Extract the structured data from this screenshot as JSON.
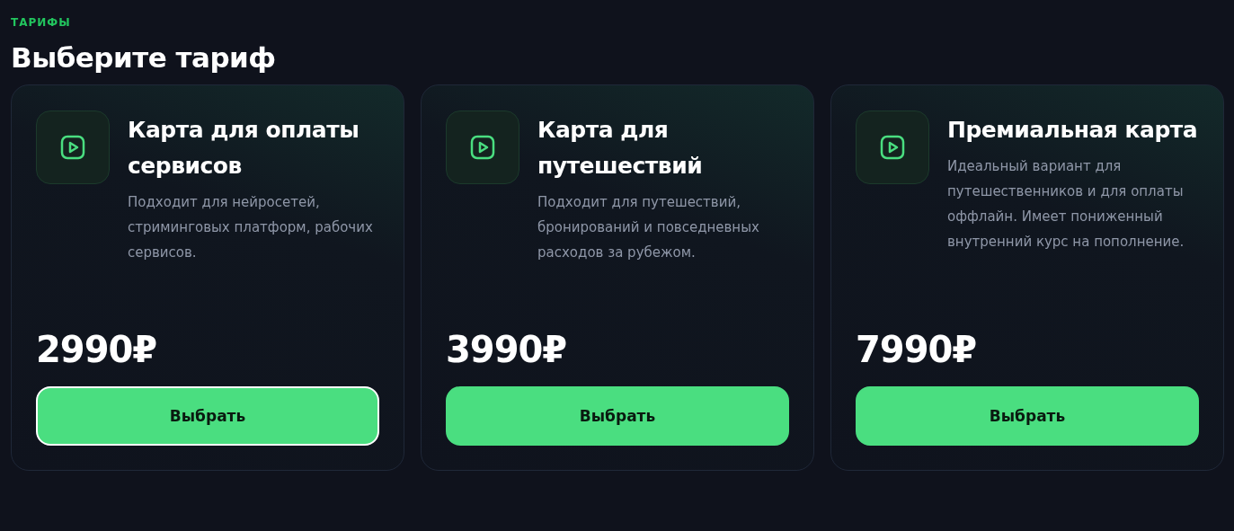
{
  "section_label": "ТАРИФЫ",
  "heading": "Выберите тариф",
  "plans": [
    {
      "title": "Карта для оплаты сервисов",
      "description": "Подходит для нейросетей, стриминговых платформ, рабочих сервисов.",
      "price": "2990₽",
      "button": "Выбрать",
      "focused": true
    },
    {
      "title": "Карта для путешествий",
      "description": "Подходит для путешествий, бронирований и повседневных расходов за рубежом.",
      "price": "3990₽",
      "button": "Выбрать",
      "focused": false
    },
    {
      "title": "Премиальная карта",
      "description": "Идеальный вариант для путешественников и для оплаты оффлайн. Имеет пониженный внутренний курс на пополнение.",
      "price": "7990₽",
      "button": "Выбрать",
      "focused": false
    }
  ]
}
